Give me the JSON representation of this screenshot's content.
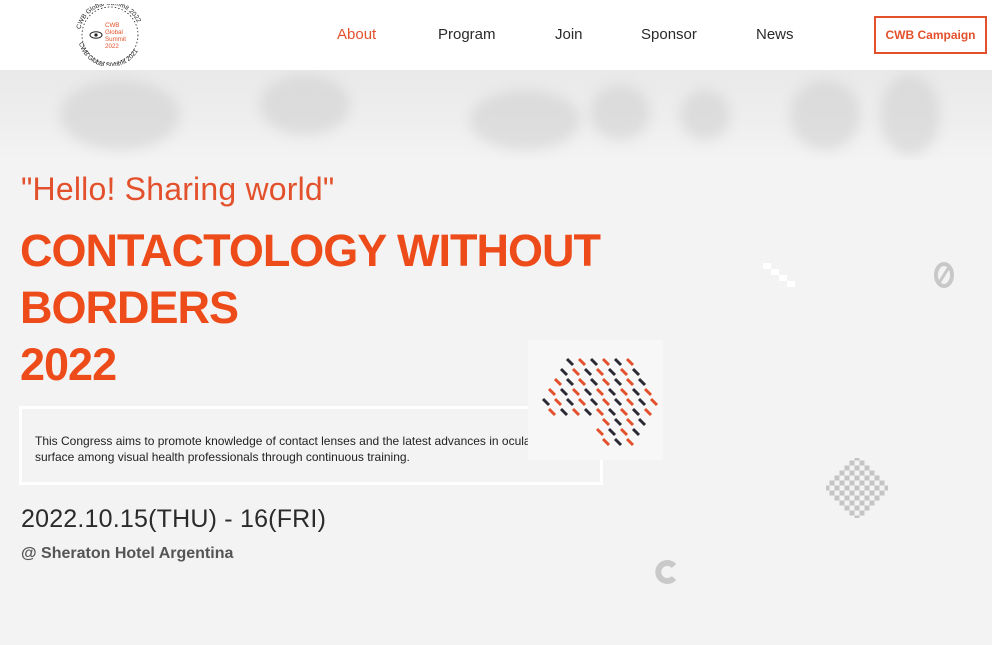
{
  "header": {
    "logo": {
      "ring_text_top": "CWB Global Summit 2022",
      "ring_text_bottom": "CWB Global Summit 2021",
      "center_lines": [
        "CWB",
        "Global",
        "Summit",
        "2022"
      ]
    },
    "nav": [
      "About",
      "Program",
      "Join",
      "Sponsor",
      "News"
    ],
    "active_nav": "About",
    "campaign_label": "CWB Campaign"
  },
  "hero": {
    "tagline": "\"Hello! Sharing world\"",
    "title_lines": [
      "CONTACTOLOGY WITHOUT",
      "BORDERS",
      "2022"
    ],
    "description_line1": "This Congress aims to promote knowledge of contact lenses and the latest advances in ocular",
    "description_line2": "surface among visual health professionals through continuous training.",
    "date": "2022.10.15(THU) - 16(FRI)",
    "venue": "@ Sheraton Hotel Argentina"
  },
  "colors": {
    "accent": "#e3512c",
    "title": "#ee4b1b",
    "text_dark": "#2b2b2b",
    "background": "#f3f3f3"
  },
  "icons": [
    "eye-icon",
    "dot-pattern-circle",
    "checker-diamond",
    "zero-glyph",
    "c-glyph"
  ]
}
